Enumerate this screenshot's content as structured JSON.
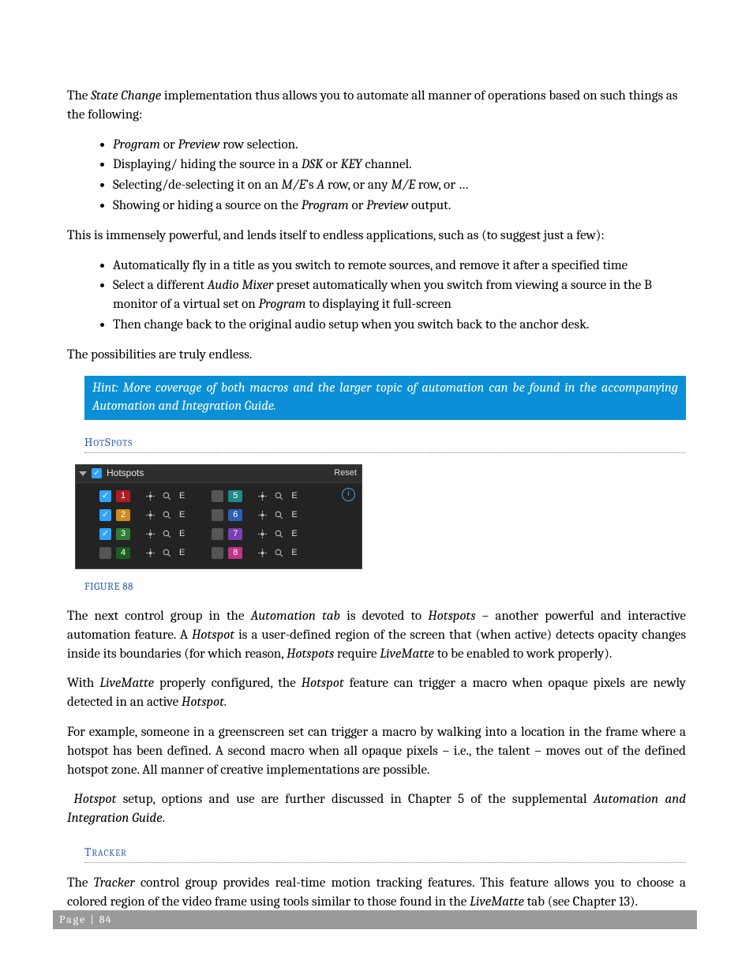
{
  "intro": {
    "p1_pre": "The ",
    "p1_em": "State Change",
    "p1_post": " implementation thus allows you to automate all manner of operations based on such things as the following:",
    "list": [
      {
        "pre": "",
        "em1": "Program",
        "mid": " or ",
        "em2": "Preview",
        "post": " row selection."
      },
      {
        "pre": "Displaying/ hiding the source in a ",
        "em1": "DSK",
        "mid": " or ",
        "em2": "KEY",
        "post": " channel."
      },
      {
        "pre": "Selecting/de-selecting it on an ",
        "em1": "M/E",
        "mid": "’s ",
        "em2": "A",
        "mid2": " row, or any ",
        "em3": "M/E",
        "post": " row, or …"
      },
      {
        "pre": "Showing or hiding a source on the ",
        "em1": "Program",
        "mid": " or ",
        "em2": "Preview",
        "post": " output."
      }
    ],
    "p2": "This is immensely powerful, and lends itself to endless applications, such as (to suggest just a few):",
    "list2": [
      "Automatically fly in a title as you switch to remote sources, and remove it after a specified time",
      {
        "pre": "Select a different ",
        "em1": "Audio Mixer",
        "mid": " preset automatically when you switch from viewing a source in the B monitor of a virtual set on ",
        "em2": "Program",
        "post": " to displaying it full-screen"
      },
      "Then change back to the original audio setup when you switch back to the anchor desk."
    ],
    "p3": "The possibilities are truly endless."
  },
  "hint": "Hint: More coverage of both macros and the larger topic of automation can be found in the accompanying Automation and Integration Guide.",
  "sections": {
    "hotspots_heading": "HotSpots",
    "tracker_heading": "Tracker"
  },
  "figure_caption": "FIGURE 88",
  "hotspots_panel": {
    "title": "Hotspots",
    "reset": "Reset",
    "info": "i",
    "check": "✓",
    "e_label": "E",
    "rows_left": [
      {
        "n": "1",
        "color": "c-red",
        "checked": true
      },
      {
        "n": "2",
        "color": "c-orange",
        "checked": true
      },
      {
        "n": "3",
        "color": "c-green",
        "checked": true
      },
      {
        "n": "4",
        "color": "c-dgreen",
        "checked": false
      }
    ],
    "rows_right": [
      {
        "n": "5",
        "color": "c-teal",
        "checked": false
      },
      {
        "n": "6",
        "color": "c-blue",
        "checked": false
      },
      {
        "n": "7",
        "color": "c-purple",
        "checked": false
      },
      {
        "n": "8",
        "color": "c-pink",
        "checked": false
      }
    ]
  },
  "body_after_figure": {
    "p1_a": "The next control group in the ",
    "p1_e1": "Automation tab",
    "p1_b": " is devoted to ",
    "p1_e2": "Hotspots",
    "p1_c": " – another powerful and interactive automation feature.  A ",
    "p1_e3": "Hotspot",
    "p1_d": " is a user-defined region of the screen that (when active) detects opacity changes inside its boundaries (for which reason, ",
    "p1_e4": "Hotspots",
    "p1_e": " require ",
    "p1_e5": "LiveMatte",
    "p1_f": " to be enabled to work properly).",
    "p2_a": "With ",
    "p2_e1": "LiveMatte",
    "p2_b": " properly configured, the ",
    "p2_e2": "Hotspot",
    "p2_c": " feature can trigger a macro when opaque pixels are newly detected in an active ",
    "p2_e3": "Hotspot.",
    "p3": "For example, someone in a greenscreen set can trigger a macro by walking into a location in the frame where a hotspot has been defined. A second macro when all opaque pixels – i.e., the talent – moves out of the defined hotspot zone. All manner of creative implementations are possible.",
    "p4_a": "Hotspot",
    "p4_b": " setup, options and use are further discussed in Chapter 5 of the supplemental ",
    "p4_e2": "Automation and Integration Guide",
    "p4_c": "."
  },
  "tracker": {
    "p1_a": "The ",
    "p1_e1": "Tracker",
    "p1_b": " control group provides real-time motion tracking features.  This feature allows you to choose a colored region of the video frame using tools similar to those found in the ",
    "p1_e2": "LiveMatte",
    "p1_c": " tab (see Chapter 13)."
  },
  "footer": {
    "label": "Page | ",
    "num": "84"
  }
}
